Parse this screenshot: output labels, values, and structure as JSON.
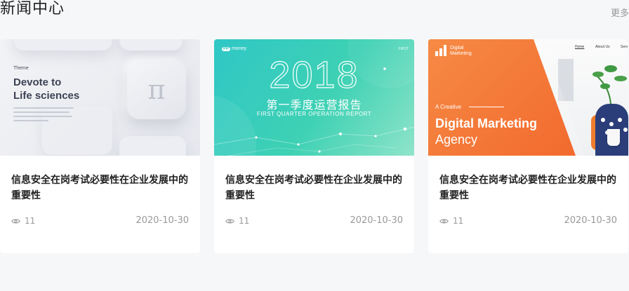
{
  "header": {
    "title": "新闻中心",
    "more_label": "更多"
  },
  "colors": {
    "page_background": "#f6f7f9",
    "card_background": "#ffffff",
    "muted_text": "#999999",
    "accent_teal": "#3ed1b4",
    "accent_orange": "#f47a3a"
  },
  "cards": [
    {
      "title": "信息安全在岗考试必要性在企业发展中的重要性",
      "views": "11",
      "date": "2020-10-30",
      "view_icon": "eye-icon",
      "thumbnail": {
        "eyebrow": "Theme",
        "headline_1": "Devote to",
        "headline_2": "Life sciences",
        "symbol": "π"
      }
    },
    {
      "title": "信息安全在岗考试必要性在企业发展中的重要性",
      "views": "11",
      "date": "2020-10-30",
      "view_icon": "eye-icon",
      "thumbnail": {
        "logo_badge": "PP",
        "logo_text": "money",
        "corner_text": "FIRST",
        "year": "2018",
        "subtitle_zh": "第一季度运营报告",
        "subtitle_en": "FIRST QUARTER OPERATION REPORT"
      }
    },
    {
      "title": "信息安全在岗考试必要性在企业发展中的重要性",
      "views": "11",
      "date": "2020-10-30",
      "view_icon": "eye-icon",
      "thumbnail": {
        "logo_line1": "Digital",
        "logo_line2": "Marketing",
        "nav": [
          "Home",
          "About Us",
          "Serv"
        ],
        "kicker": "A Creative",
        "headline_1": "Digital Marketing",
        "headline_2": "Agency"
      }
    }
  ]
}
